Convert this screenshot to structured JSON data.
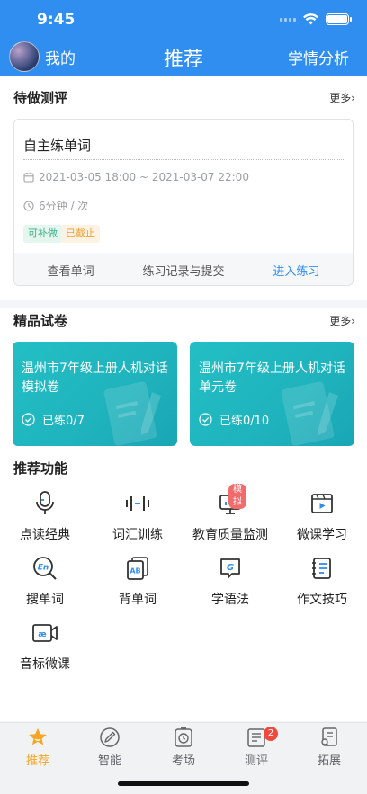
{
  "status_bar": {
    "time": "9:45"
  },
  "header": {
    "my_label": "我的",
    "title": "推荐",
    "analysis_label": "学情分析"
  },
  "pending": {
    "title": "待做测评",
    "more": "更多›",
    "task": {
      "name": "自主练单词",
      "date_range": "2021-03-05 18:00 ~ 2021-03-07 22:00",
      "duration": "6分钟 / 次",
      "tags": [
        "可补做",
        "已截止"
      ],
      "actions": [
        "查看单词",
        "练习记录与提交",
        "进入练习"
      ]
    }
  },
  "papers": {
    "title": "精品试卷",
    "more": "更多›",
    "items": [
      {
        "title": "温州市7年级上册人机对话模拟卷",
        "status": "已练0/7"
      },
      {
        "title": "温州市7年级上册人机对话单元卷",
        "status": "已练0/10"
      }
    ]
  },
  "features": {
    "title": "推荐功能",
    "items": [
      {
        "label": "点读经典",
        "icon": "microphone-icon"
      },
      {
        "label": "词汇训练",
        "icon": "soundwave-icon"
      },
      {
        "label": "教育质量监测",
        "icon": "monitor-chart-icon",
        "badge": "模拟"
      },
      {
        "label": "微课学习",
        "icon": "video-play-icon"
      },
      {
        "label": "搜单词",
        "icon": "search-en-icon"
      },
      {
        "label": "背单词",
        "icon": "ab-cards-icon"
      },
      {
        "label": "学语法",
        "icon": "grammar-g-icon"
      },
      {
        "label": "作文技巧",
        "icon": "notebook-icon"
      },
      {
        "label": "音标微课",
        "icon": "phonetic-video-icon"
      }
    ]
  },
  "tabbar": {
    "items": [
      {
        "label": "推荐",
        "icon": "star-icon",
        "active": true
      },
      {
        "label": "智能",
        "icon": "compass-pen-icon"
      },
      {
        "label": "考场",
        "icon": "clock-icon"
      },
      {
        "label": "测评",
        "icon": "test-paper-icon",
        "badge": "2"
      },
      {
        "label": "拓展",
        "icon": "expand-doc-icon"
      }
    ]
  },
  "colors": {
    "primary": "#2f8ef0",
    "teal_card": "#1fb3bd",
    "active_tab": "#f5a623",
    "badge_red": "#f04a3e"
  }
}
